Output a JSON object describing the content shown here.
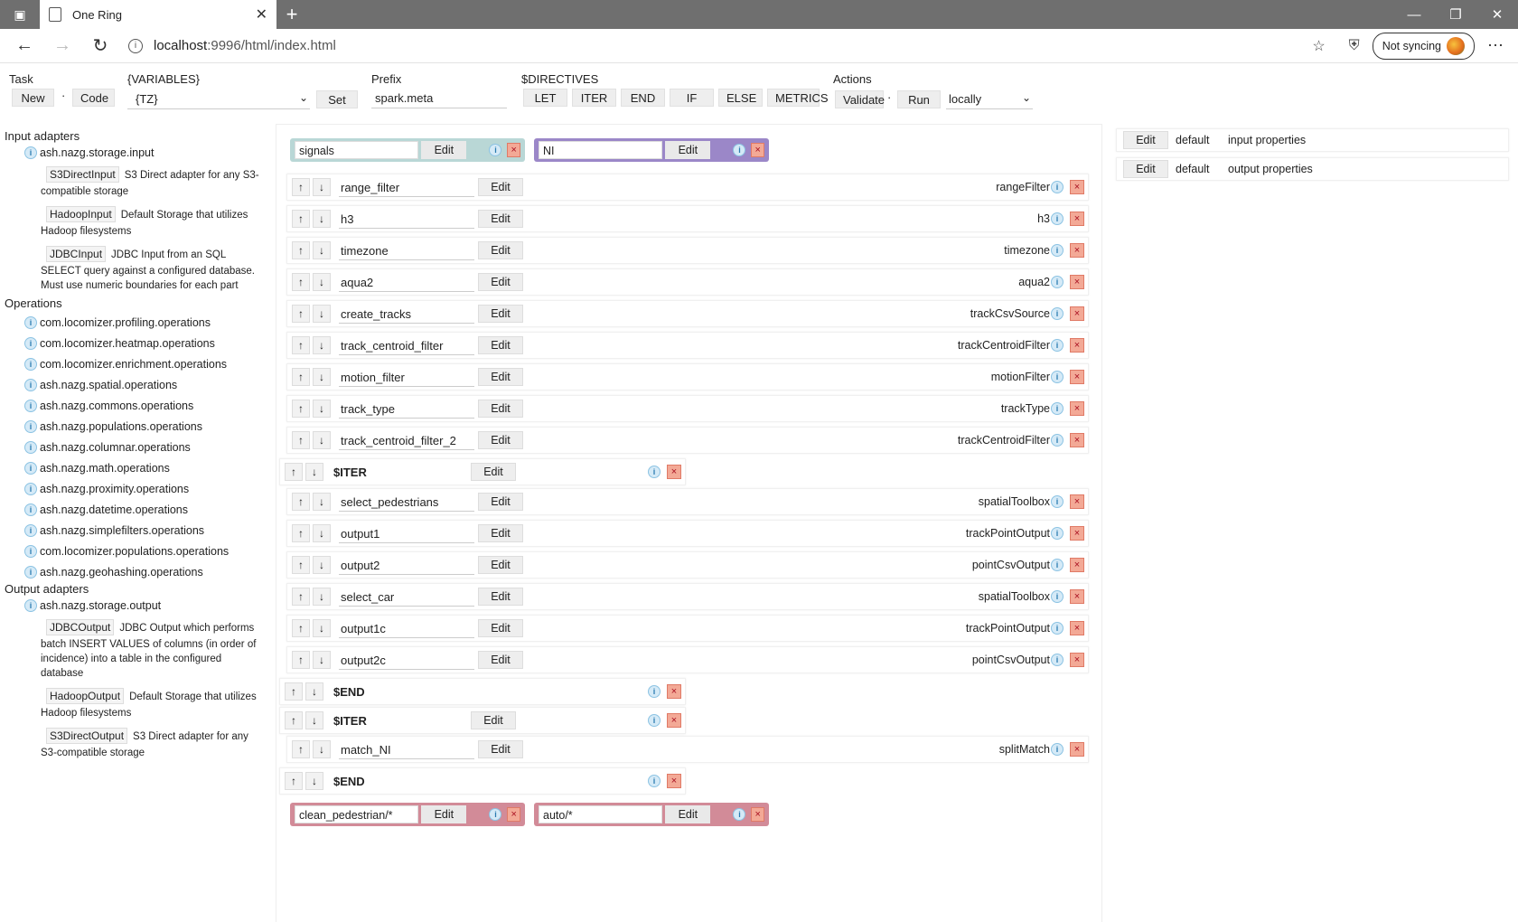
{
  "browser": {
    "tab_title": "One Ring",
    "url_host": "localhost",
    "url_rest": ":9996/html/index.html",
    "sync_label": "Not syncing"
  },
  "toolbar": {
    "task_label": "Task",
    "new_label": "New",
    "code_label": "Code",
    "variables_label": "{VARIABLES}",
    "variables_value": "{TZ}",
    "set_label": "Set",
    "prefix_label": "Prefix",
    "prefix_value": "spark.meta",
    "directives_label": "$DIRECTIVES",
    "directives": [
      "LET",
      "ITER",
      "END",
      "IF",
      "ELSE",
      "METRICS"
    ],
    "actions_label": "Actions",
    "validate_label": "Validate",
    "run_label": "Run",
    "run_mode": "locally",
    "dot": "·"
  },
  "sidebar": {
    "input_header": "Input adapters",
    "input_pkg": "ash.nazg.storage.input",
    "input_adapters": [
      {
        "name": "S3DirectInput",
        "desc": "S3 Direct adapter for any S3-compatible storage"
      },
      {
        "name": "HadoopInput",
        "desc": "Default Storage that utilizes Hadoop filesystems"
      },
      {
        "name": "JDBCInput",
        "desc": "JDBC Input from an SQL SELECT query against a configured database. Must use numeric boundaries for each part"
      }
    ],
    "ops_header": "Operations",
    "operations": [
      "com.locomizer.profiling.operations",
      "com.locomizer.heatmap.operations",
      "com.locomizer.enrichment.operations",
      "ash.nazg.spatial.operations",
      "ash.nazg.commons.operations",
      "ash.nazg.populations.operations",
      "ash.nazg.columnar.operations",
      "ash.nazg.math.operations",
      "ash.nazg.proximity.operations",
      "ash.nazg.datetime.operations",
      "ash.nazg.simplefilters.operations",
      "com.locomizer.populations.operations",
      "ash.nazg.geohashing.operations"
    ],
    "output_header": "Output adapters",
    "output_pkg": "ash.nazg.storage.output",
    "output_adapters": [
      {
        "name": "JDBCOutput",
        "desc": "JDBC Output which performs batch INSERT VALUES of columns (in order of incidence) into a table in the configured database"
      },
      {
        "name": "HadoopOutput",
        "desc": "Default Storage that utilizes Hadoop filesystems"
      },
      {
        "name": "S3DirectOutput",
        "desc": "S3 Direct adapter for any S3-compatible storage"
      }
    ]
  },
  "flow": {
    "inputs": [
      {
        "value": "signals",
        "color": "#b9d7d6"
      },
      {
        "value": "NI",
        "color": "#9b87c8"
      }
    ],
    "outputs": [
      {
        "value": "clean_pedestrian/*",
        "color": "#d28b98"
      },
      {
        "value": "auto/*",
        "color": "#d28b98"
      }
    ],
    "edit_label": "Edit",
    "up": "↑",
    "down": "↓",
    "close": "×",
    "info": "i",
    "rows": [
      {
        "name": "range_filter",
        "op": "rangeFilter",
        "kind": "op"
      },
      {
        "name": "h3",
        "op": "h3",
        "kind": "op"
      },
      {
        "name": "timezone",
        "op": "timezone",
        "kind": "op"
      },
      {
        "name": "aqua2",
        "op": "aqua2",
        "kind": "op"
      },
      {
        "name": "create_tracks",
        "op": "trackCsvSource",
        "kind": "op"
      },
      {
        "name": "track_centroid_filter",
        "op": "trackCentroidFilter",
        "kind": "op"
      },
      {
        "name": "motion_filter",
        "op": "motionFilter",
        "kind": "op"
      },
      {
        "name": "track_type",
        "op": "trackType",
        "kind": "op"
      },
      {
        "name": "track_centroid_filter_2",
        "op": "trackCentroidFilter",
        "kind": "op"
      },
      {
        "name": "$ITER",
        "op": "",
        "kind": "dir-edit"
      },
      {
        "name": "select_pedestrians",
        "op": "spatialToolbox",
        "kind": "op"
      },
      {
        "name": "output1",
        "op": "trackPointOutput",
        "kind": "op"
      },
      {
        "name": "output2",
        "op": "pointCsvOutput",
        "kind": "op"
      },
      {
        "name": "select_car",
        "op": "spatialToolbox",
        "kind": "op"
      },
      {
        "name": "output1c",
        "op": "trackPointOutput",
        "kind": "op"
      },
      {
        "name": "output2c",
        "op": "pointCsvOutput",
        "kind": "op"
      },
      {
        "name": "$END",
        "op": "",
        "kind": "dir"
      },
      {
        "name": "$ITER",
        "op": "",
        "kind": "dir-edit"
      },
      {
        "name": "match_NI",
        "op": "splitMatch",
        "kind": "op"
      },
      {
        "name": "$END",
        "op": "",
        "kind": "dir"
      }
    ]
  },
  "properties": [
    {
      "edit": "Edit",
      "name": "default",
      "desc": "input properties"
    },
    {
      "edit": "Edit",
      "name": "default",
      "desc": "output properties"
    }
  ]
}
